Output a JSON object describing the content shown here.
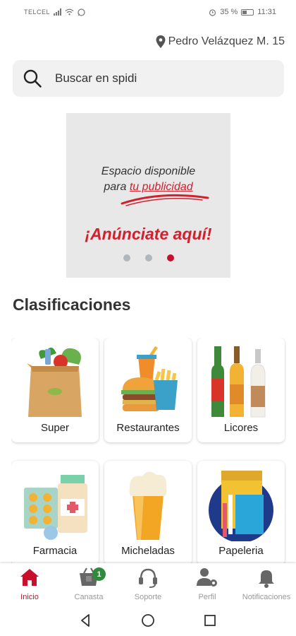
{
  "status_bar": {
    "carrier": "TELCEL",
    "battery": "35 %",
    "time": "11:31"
  },
  "location": {
    "text": "Pedro Velázquez M. 15",
    "icon": "location-pin-icon"
  },
  "search": {
    "placeholder": "Buscar en spidi",
    "icon": "search-icon"
  },
  "banner": {
    "line1": "Espacio disponible",
    "line2_prefix": "para",
    "line2_highlight": "tu publicidad",
    "cta": "¡Anúnciate aquí!",
    "slides": 3,
    "active_slide": 3
  },
  "section_title": "Clasificaciones",
  "categories": [
    {
      "label": "Super",
      "icon": "grocery-bag-icon"
    },
    {
      "label": "Restaurantes",
      "icon": "burger-fries-icon"
    },
    {
      "label": "Licores",
      "icon": "liquor-bottles-icon"
    },
    {
      "label": "Farmacia",
      "icon": "pharmacy-pills-icon"
    },
    {
      "label": "Micheladas",
      "icon": "beer-glass-icon"
    },
    {
      "label": "Papeleria",
      "icon": "stationery-icon"
    }
  ],
  "bottom_nav": [
    {
      "label": "Inicio",
      "icon": "home-icon",
      "active": true
    },
    {
      "label": "Canasta",
      "icon": "basket-icon",
      "badge": "1"
    },
    {
      "label": "Soporte",
      "icon": "headset-icon"
    },
    {
      "label": "Perfil",
      "icon": "user-gear-icon"
    },
    {
      "label": "Notificaciones",
      "icon": "bell-icon"
    }
  ],
  "colors": {
    "accent": "#c8102e",
    "badge": "#2e8b3c",
    "search_bg": "#f1f1f1",
    "banner_bg": "#e8e8e8"
  }
}
